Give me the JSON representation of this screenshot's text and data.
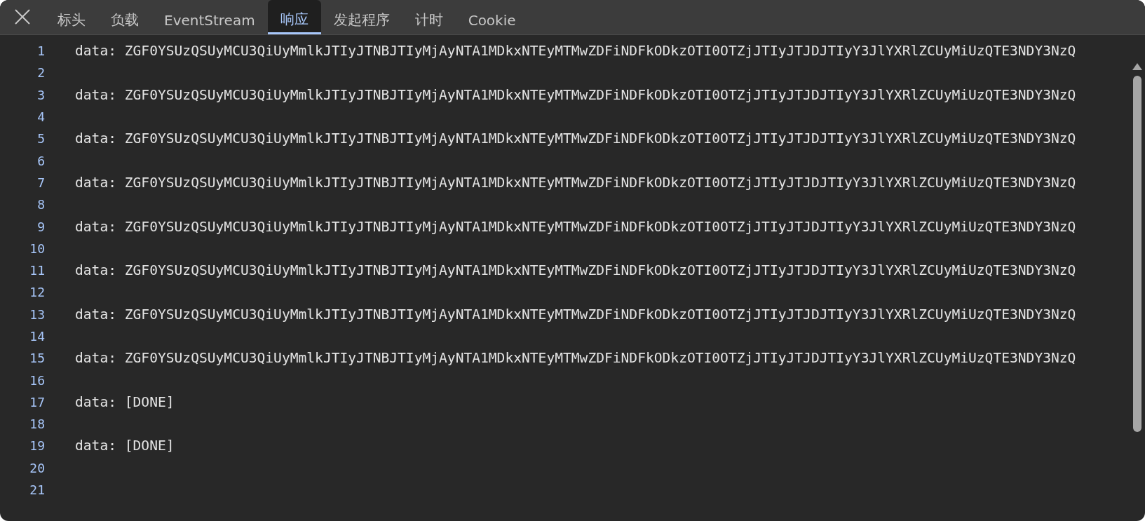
{
  "tabs": [
    {
      "label": "标头",
      "selected": false
    },
    {
      "label": "负载",
      "selected": false
    },
    {
      "label": "EventStream",
      "selected": false
    },
    {
      "label": "响应",
      "selected": true
    },
    {
      "label": "发起程序",
      "selected": false
    },
    {
      "label": "计时",
      "selected": false
    },
    {
      "label": "Cookie",
      "selected": false
    }
  ],
  "lines": [
    {
      "number": "1",
      "text": "data: ZGF0YSUzQSUyMCU3QiUyMmlkJTIyJTNBJTIyMjAyNTA1MDkxNTEyMTMwZDFiNDFkODkzOTI0OTZjJTIyJTJDJTIyY3JlYXRlZCUyMiUzQTE3NDY3NzQ"
    },
    {
      "number": "2"
    },
    {
      "number": "3",
      "text": "data: ZGF0YSUzQSUyMCU3QiUyMmlkJTIyJTNBJTIyMjAyNTA1MDkxNTEyMTMwZDFiNDFkODkzOTI0OTZjJTIyJTJDJTIyY3JlYXRlZCUyMiUzQTE3NDY3NzQ"
    },
    {
      "number": "4"
    },
    {
      "number": "5",
      "text": "data: ZGF0YSUzQSUyMCU3QiUyMmlkJTIyJTNBJTIyMjAyNTA1MDkxNTEyMTMwZDFiNDFkODkzOTI0OTZjJTIyJTJDJTIyY3JlYXRlZCUyMiUzQTE3NDY3NzQ"
    },
    {
      "number": "6"
    },
    {
      "number": "7",
      "text": "data: ZGF0YSUzQSUyMCU3QiUyMmlkJTIyJTNBJTIyMjAyNTA1MDkxNTEyMTMwZDFiNDFkODkzOTI0OTZjJTIyJTJDJTIyY3JlYXRlZCUyMiUzQTE3NDY3NzQ"
    },
    {
      "number": "8"
    },
    {
      "number": "9",
      "text": "data: ZGF0YSUzQSUyMCU3QiUyMmlkJTIyJTNBJTIyMjAyNTA1MDkxNTEyMTMwZDFiNDFkODkzOTI0OTZjJTIyJTJDJTIyY3JlYXRlZCUyMiUzQTE3NDY3NzQ"
    },
    {
      "number": "10"
    },
    {
      "number": "11",
      "text": "data: ZGF0YSUzQSUyMCU3QiUyMmlkJTIyJTNBJTIyMjAyNTA1MDkxNTEyMTMwZDFiNDFkODkzOTI0OTZjJTIyJTJDJTIyY3JlYXRlZCUyMiUzQTE3NDY3NzQ"
    },
    {
      "number": "12"
    },
    {
      "number": "13",
      "text": "data: ZGF0YSUzQSUyMCU3QiUyMmlkJTIyJTNBJTIyMjAyNTA1MDkxNTEyMTMwZDFiNDFkODkzOTI0OTZjJTIyJTJDJTIyY3JlYXRlZCUyMiUzQTE3NDY3NzQ"
    },
    {
      "number": "14"
    },
    {
      "number": "15",
      "text": "data: ZGF0YSUzQSUyMCU3QiUyMmlkJTIyJTNBJTIyMjAyNTA1MDkxNTEyMTMwZDFiNDFkODkzOTI0OTZjJTIyJTJDJTIyY3JlYXRlZCUyMiUzQTE3NDY3NzQ"
    },
    {
      "number": "16"
    },
    {
      "number": "17",
      "text": "data: [DONE]"
    },
    {
      "number": "18"
    },
    {
      "number": "19",
      "text": "data: [DONE]"
    },
    {
      "number": "20"
    },
    {
      "number": "21"
    }
  ]
}
